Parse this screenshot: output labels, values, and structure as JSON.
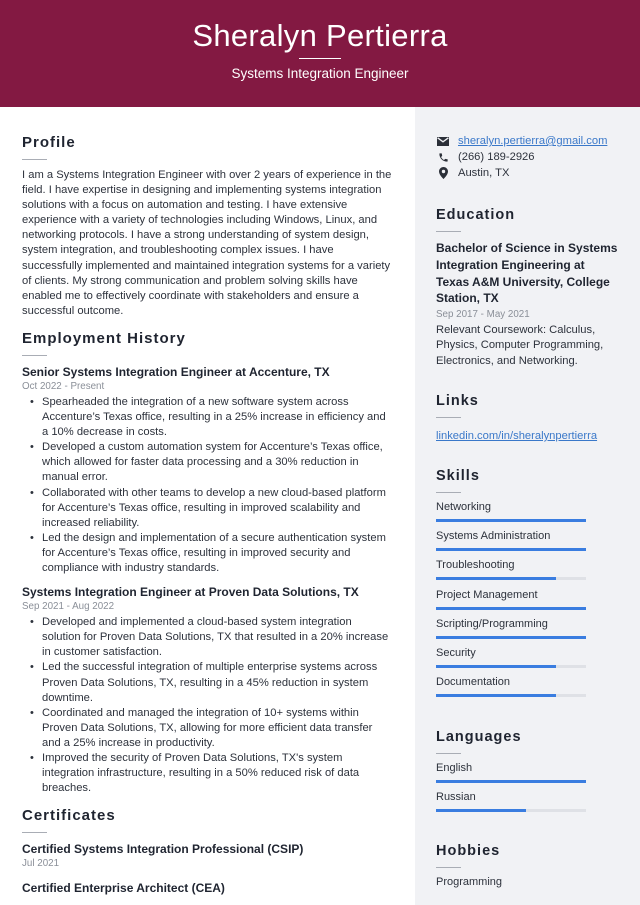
{
  "header": {
    "name": "Sheralyn Pertierra",
    "title": "Systems Integration Engineer",
    "bg_color": "#831942"
  },
  "profile": {
    "heading": "Profile",
    "text": "I am a Systems Integration Engineer with over 2 years of experience in the field. I have expertise in designing and implementing systems integration solutions with a focus on automation and testing. I have extensive experience with a variety of technologies including Windows, Linux, and networking protocols. I have a strong understanding of system design, system integration, and troubleshooting complex issues. I have successfully implemented and maintained integration systems for a variety of clients. My strong communication and problem solving skills have enabled me to effectively coordinate with stakeholders and ensure a successful outcome."
  },
  "employment": {
    "heading": "Employment History",
    "jobs": [
      {
        "title": "Senior Systems Integration Engineer at Accenture, TX",
        "dates": "Oct 2022 - Present",
        "bullets": [
          "Spearheaded the integration of a new software system across Accenture’s Texas office, resulting in a 25% increase in efficiency and a 10% decrease in costs.",
          "Developed a custom automation system for Accenture’s Texas office, which allowed for faster data processing and a 30% reduction in manual error.",
          "Collaborated with other teams to develop a new cloud-based platform for Accenture’s Texas office, resulting in improved scalability and increased reliability.",
          "Led the design and implementation of a secure authentication system for Accenture’s Texas office, resulting in improved security and compliance with industry standards."
        ]
      },
      {
        "title": "Systems Integration Engineer at Proven Data Solutions, TX",
        "dates": "Sep 2021 - Aug 2022",
        "bullets": [
          "Developed and implemented a cloud-based system integration solution for Proven Data Solutions, TX that resulted in a 20% increase in customer satisfaction.",
          "Led the successful integration of multiple enterprise systems across Proven Data Solutions, TX, resulting in a 45% reduction in system downtime.",
          "Coordinated and managed the integration of 10+ systems within Proven Data Solutions, TX, allowing for more efficient data transfer and a 25% increase in productivity.",
          "Improved the security of Proven Data Solutions, TX's system integration infrastructure, resulting in a 50% reduced risk of data breaches."
        ]
      }
    ]
  },
  "certificates": {
    "heading": "Certificates",
    "items": [
      {
        "name": "Certified Systems Integration Professional (CSIP)",
        "date": "Jul 2021"
      },
      {
        "name": "Certified Enterprise Architect (CEA)",
        "date": ""
      }
    ]
  },
  "contact": {
    "email": "sheralyn.pertierra@gmail.com",
    "phone": "(266) 189-2926",
    "location": "Austin, TX",
    "icons": [
      "envelope-icon",
      "phone-icon",
      "map-pin-icon"
    ]
  },
  "education": {
    "heading": "Education",
    "degree": "Bachelor of Science in Systems Integration Engineering at Texas A&M University, College Station, TX",
    "dates": "Sep 2017 - May 2021",
    "description": "Relevant Coursework: Calculus, Physics, Computer Programming, Electronics, and Networking."
  },
  "links": {
    "heading": "Links",
    "items": [
      "linkedin.com/in/sheralynpertierra"
    ]
  },
  "skills": {
    "heading": "Skills",
    "bar_color": "#3a7de0",
    "items": [
      {
        "name": "Networking",
        "level": 1.0
      },
      {
        "name": "Systems Administration",
        "level": 1.0
      },
      {
        "name": "Troubleshooting",
        "level": 0.8
      },
      {
        "name": "Project Management",
        "level": 1.0
      },
      {
        "name": "Scripting/Programming",
        "level": 1.0
      },
      {
        "name": "Security",
        "level": 0.8
      },
      {
        "name": "Documentation",
        "level": 0.8
      }
    ]
  },
  "languages": {
    "heading": "Languages",
    "items": [
      {
        "name": "English",
        "level": 1.0
      },
      {
        "name": "Russian",
        "level": 0.6
      }
    ]
  },
  "hobbies": {
    "heading": "Hobbies",
    "items": [
      "Programming"
    ]
  }
}
